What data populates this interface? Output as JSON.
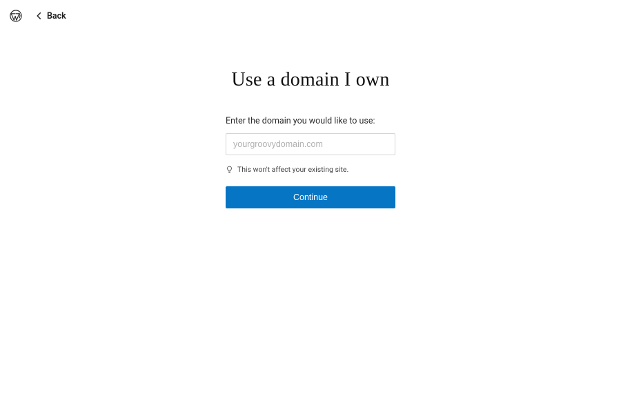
{
  "header": {
    "back_label": "Back"
  },
  "main": {
    "title": "Use a domain I own",
    "label": "Enter the domain you would like to use:",
    "input_placeholder": "yourgroovydomain.com",
    "hint": "This won't affect your existing site.",
    "continue_label": "Continue"
  }
}
